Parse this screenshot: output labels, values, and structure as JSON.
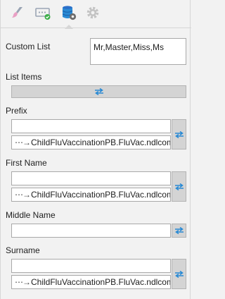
{
  "tabs": [
    {
      "icon": "paintbrush-icon"
    },
    {
      "icon": "input-field-icon"
    },
    {
      "icon": "database-settings-icon",
      "active": true
    },
    {
      "icon": "gear-icon"
    }
  ],
  "custom_list": {
    "label": "Custom List",
    "value": "Mr,Master,Miss,Ms"
  },
  "list_items": {
    "label": "List Items"
  },
  "fields": {
    "prefix": {
      "label": "Prefix",
      "value": "",
      "mapping": "ChildFluVaccinationPB.FluVac.ndlcomp"
    },
    "first_name": {
      "label": "First Name",
      "value": "",
      "mapping": "ChildFluVaccinationPB.FluVac.ndlcomp"
    },
    "middle_name": {
      "label": "Middle Name",
      "value": ""
    },
    "surname": {
      "label": "Surname",
      "value": "",
      "mapping": "ChildFluVaccinationPB.FluVac.ndlcomp"
    }
  },
  "colors": {
    "accent": "#2a8ad4",
    "panel_bg": "#f2f2f2",
    "button_bg": "#d4d4d4"
  }
}
